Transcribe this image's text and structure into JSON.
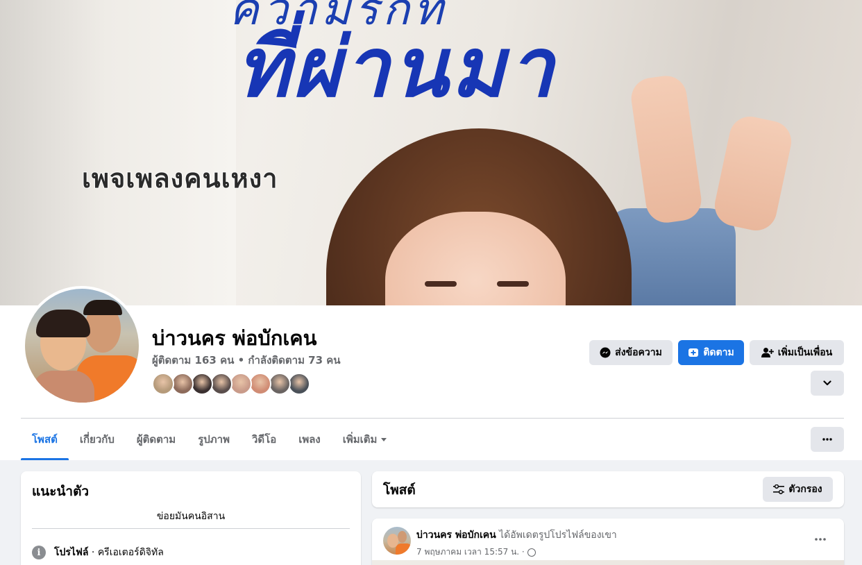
{
  "cover": {
    "line_top": "ความรักที่",
    "line_big": "ที่ผ่านมา",
    "line_sub": "เพจเพลงคนเหงา"
  },
  "profile": {
    "name": "บ่าวนคร พ่อบักเคน",
    "stats": "ผู้ติดตาม 163 คน • กำลังติดตาม 73 คน",
    "follower_avatar_colors": [
      "#b59a7a",
      "#8d6b5b",
      "#3a3030",
      "#5a4e4c",
      "#c99b8a",
      "#d08c74",
      "#6a6462",
      "#4a5058"
    ]
  },
  "actions": {
    "message": "ส่งข้อความ",
    "follow": "ติดตาม",
    "add_friend": "เพิ่มเป็นเพื่อน"
  },
  "tabs": [
    {
      "label": "โพสต์",
      "active": true
    },
    {
      "label": "เกี่ยวกับ",
      "active": false
    },
    {
      "label": "ผู้ติดตาม",
      "active": false
    },
    {
      "label": "รูปภาพ",
      "active": false
    },
    {
      "label": "วิดีโอ",
      "active": false
    },
    {
      "label": "เพลง",
      "active": false
    },
    {
      "label": "เพิ่มเติม",
      "active": false
    }
  ],
  "intro": {
    "title": "แนะนำตัว",
    "bio": "ข่อยมันคนอิสาน",
    "profile_label": "โปรไฟล์",
    "profile_category": " · ครีเอเตอร์ดิจิทัล"
  },
  "posts": {
    "title": "โพสต์",
    "filter_label": "ตัวกรอง",
    "first_post": {
      "author": "บ่าวนคร พ่อบักเคน",
      "action": " ได้อัพเดตรูปโปรไฟล์ของเขา",
      "time": "7 พฤษภาคม เวลา 15:57 น. ·"
    }
  },
  "colors": {
    "accent": "#1b74e4",
    "page_bg": "#f0f2f5",
    "button_gray": "#e4e6eb",
    "text_secondary": "#65676b"
  }
}
